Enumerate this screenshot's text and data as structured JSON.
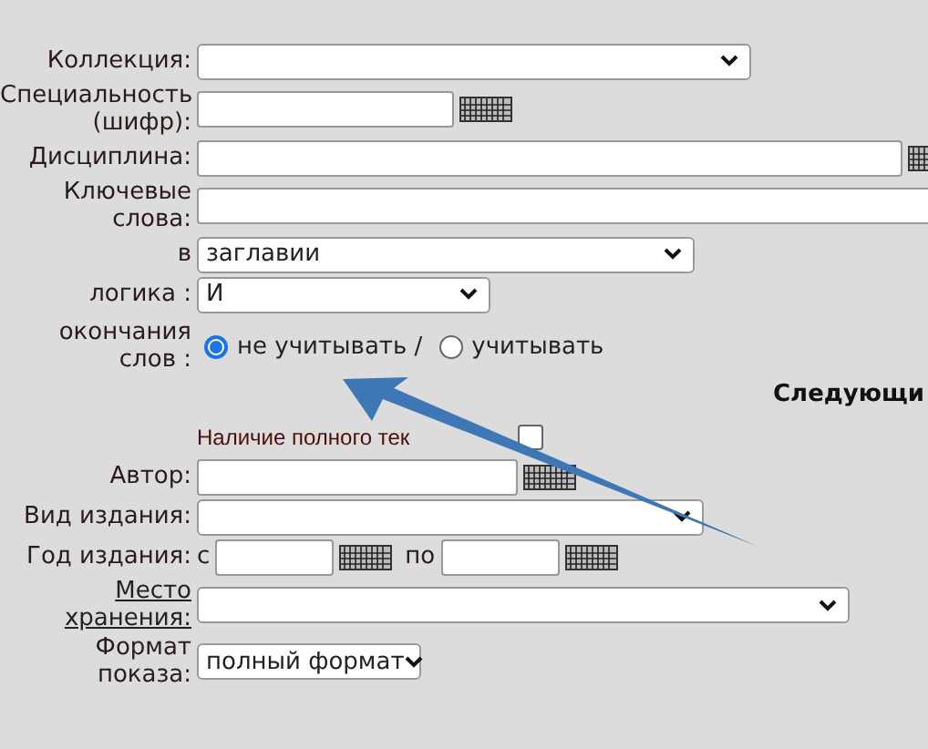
{
  "rows": [
    {
      "kind": "select",
      "label": "Коллекция:"
    },
    {
      "kind": "input_kb",
      "label": "Специальность (шифр):"
    },
    {
      "kind": "input_kb",
      "label": "Дисциплина:"
    },
    {
      "kind": "input",
      "label": "Ключевые слова:"
    },
    {
      "kind": "select",
      "label": "в",
      "value": "заглавии"
    },
    {
      "kind": "select",
      "label": "логика :",
      "value": "И"
    },
    {
      "kind": "radios",
      "label": "окончания слов :",
      "options": [
        {
          "label": "не учитывать /",
          "selected": true
        },
        {
          "label": "учитывать",
          "selected": false
        }
      ]
    },
    {
      "kind": "heading",
      "text": "Следующи"
    },
    {
      "kind": "checkbox",
      "text": "Наличие полного тек",
      "checked": false
    },
    {
      "kind": "input_kb",
      "label": "Автор:"
    },
    {
      "kind": "select",
      "label": "Вид издания:"
    },
    {
      "kind": "range",
      "label": "Год издания:",
      "from": "с",
      "to": "по"
    },
    {
      "kind": "select",
      "label": "Место хранения:",
      "link": true
    },
    {
      "kind": "select",
      "label": "Формат показа:",
      "value": "полный формат"
    }
  ]
}
